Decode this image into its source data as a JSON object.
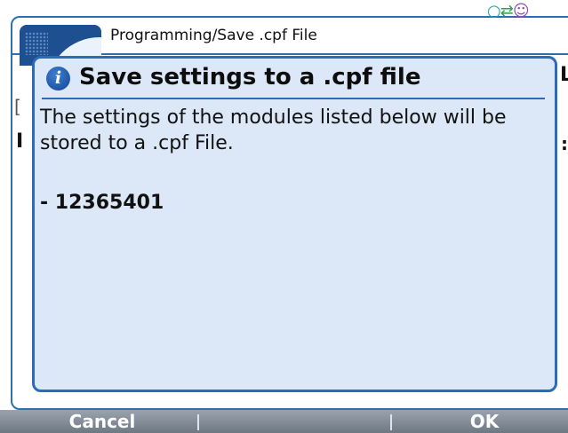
{
  "window": {
    "title": "Programming/Save .cpf File",
    "status_icons": [
      "network-status-icon",
      "connection-arrows-icon",
      "user-icon"
    ]
  },
  "background": {
    "fragments": [
      "[",
      "I",
      "L",
      ":"
    ]
  },
  "dialog": {
    "icon": "info-icon",
    "icon_glyph": "i",
    "title": "Save settings to a .cpf file",
    "message": "The settings of the modules listed below will be stored to a .cpf File.",
    "items": [
      "- 12365401"
    ]
  },
  "softkeys": {
    "left_label": "Cancel",
    "middle_label": "",
    "right_label": "OK"
  },
  "colors": {
    "dialog_background": "#dce8f7",
    "dialog_border": "#2a6cb5",
    "softkey_bar": "#7f8893"
  }
}
